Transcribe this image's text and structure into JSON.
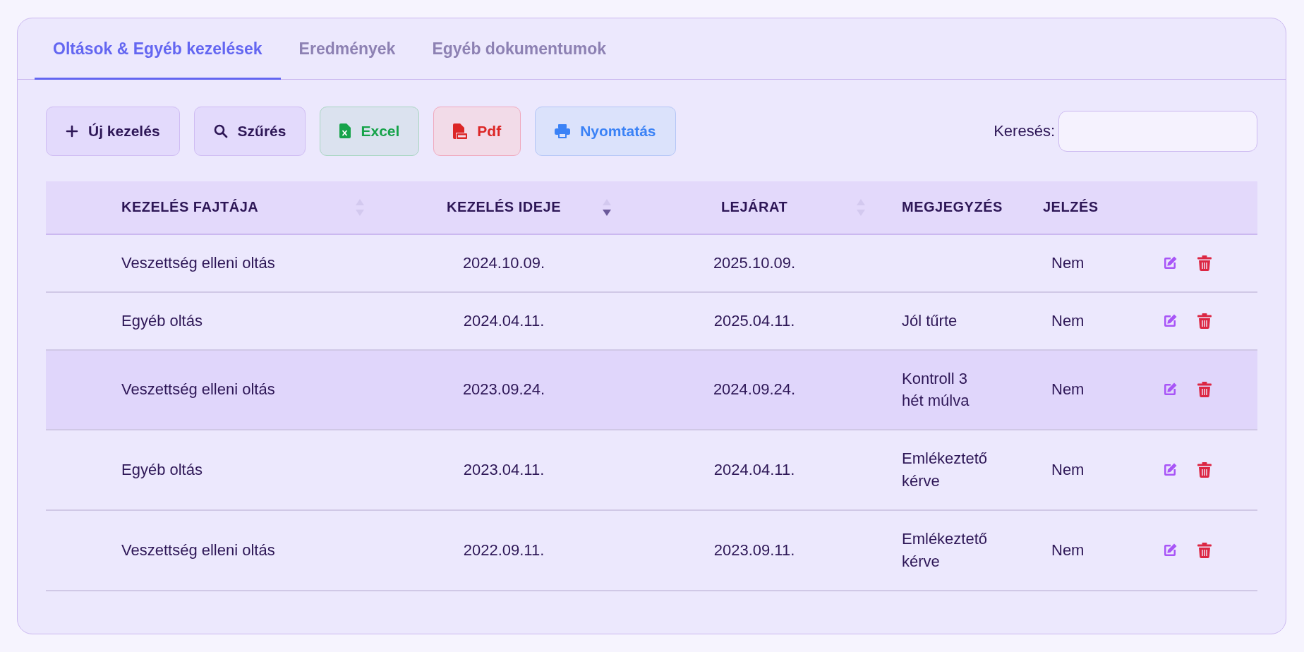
{
  "tabs": [
    {
      "label": "Oltások & Egyéb kezelések",
      "selected": true
    },
    {
      "label": "Eredmények",
      "selected": false
    },
    {
      "label": "Egyéb dokumentumok",
      "selected": false
    }
  ],
  "toolbar": {
    "buttons": [
      {
        "kind": "add",
        "label": "Új kezelés"
      },
      {
        "kind": "filter",
        "label": "Szűrés"
      },
      {
        "kind": "excel",
        "label": "Excel"
      },
      {
        "kind": "pdf",
        "label": "Pdf"
      },
      {
        "kind": "print",
        "label": "Nyomtatás"
      }
    ],
    "search": {
      "label": "Keresés:"
    }
  },
  "table": {
    "columns": [
      {
        "label": "KEZELÉS FAJTÁJA",
        "sortable": true,
        "sorted_desc": false
      },
      {
        "label": "KEZELÉS IDEJE",
        "sortable": true,
        "sorted_desc": true
      },
      {
        "label": "LEJÁRAT",
        "sortable": true,
        "sorted_desc": false
      },
      {
        "label": "MEGJEGYZÉS"
      },
      {
        "label": "JELZÉS"
      }
    ],
    "rows": [
      {
        "type": "Veszettség elleni oltás",
        "date": "2024.10.09.",
        "expiry": "2025.10.09.",
        "flag": "Nem",
        "hovered": false
      },
      {
        "type": "Egyéb oltás",
        "date": "2024.04.11.",
        "expiry": "2025.04.11.",
        "note": "Jól tűrte",
        "flag": "Nem",
        "hovered": false
      },
      {
        "type": "Veszettség elleni oltás",
        "date": "2023.09.24.",
        "expiry": "2024.09.24.",
        "note": "Kontroll 3 hét múlva",
        "flag": "Nem",
        "hovered": true
      },
      {
        "type": "Egyéb oltás",
        "date": "2023.04.11.",
        "expiry": "2024.04.11.",
        "note": "Emlékeztető kérve",
        "flag": "Nem",
        "hovered": false
      },
      {
        "type": "Veszettség elleni oltás",
        "date": "2022.09.11.",
        "expiry": "2023.09.11.",
        "note": "Emlékeztető kérve",
        "flag": "Nem",
        "hovered": false
      }
    ]
  }
}
